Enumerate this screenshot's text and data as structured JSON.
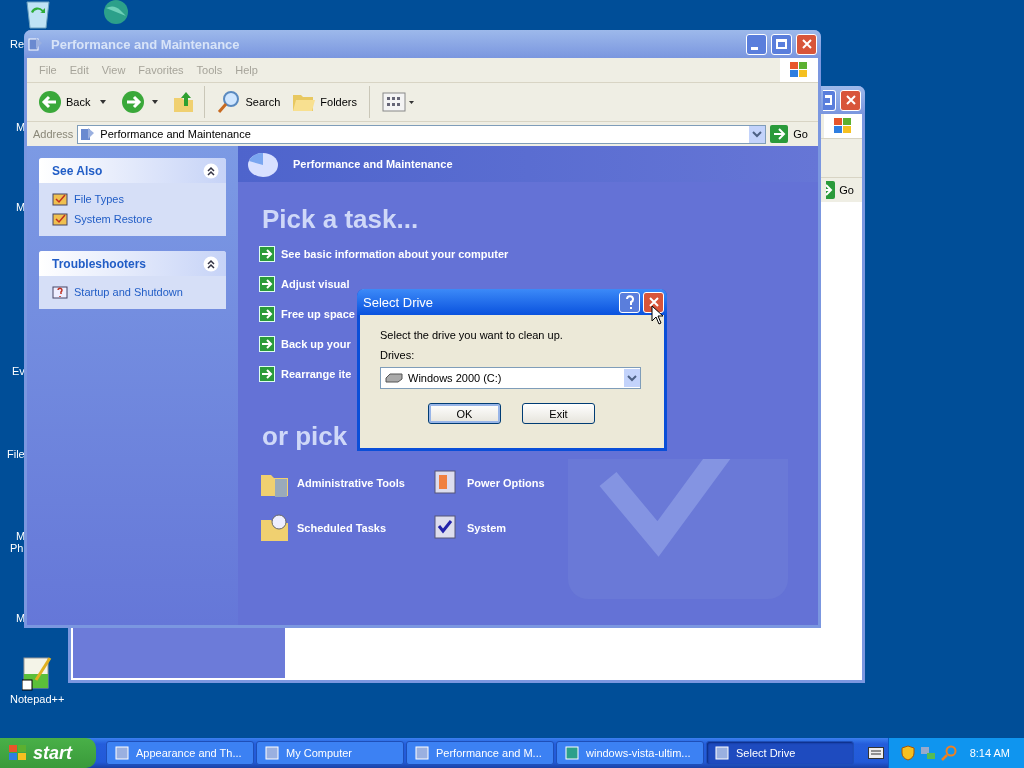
{
  "desktop_labels": [
    "Re",
    "M",
    "M",
    "Ev",
    "File",
    "M",
    "Ph",
    "M",
    "Notepad++"
  ],
  "back_window": {
    "go_label": "Go"
  },
  "main_window": {
    "title": "Performance and Maintenance",
    "menu": [
      "File",
      "Edit",
      "View",
      "Favorites",
      "Tools",
      "Help"
    ],
    "toolbar": {
      "back": "Back",
      "search": "Search",
      "folders": "Folders"
    },
    "address": {
      "label": "Address",
      "value": "Performance and Maintenance",
      "go": "Go"
    },
    "side_panels": [
      {
        "title": "See Also",
        "expanded": true,
        "items": [
          "File Types",
          "System Restore"
        ]
      },
      {
        "title": "Troubleshooters",
        "expanded": true,
        "items": [
          "Startup and Shutdown"
        ]
      }
    ],
    "header": "Performance and Maintenance",
    "pick_task": "Pick a task...",
    "tasks": [
      "See basic information about your computer",
      "Adjust visual",
      "Free up space",
      "Back up your",
      "Rearrange ite"
    ],
    "or_pick": "or pick",
    "icons": [
      "Administrative Tools",
      "Power Options",
      "Scheduled Tasks",
      "System"
    ]
  },
  "dialog": {
    "title": "Select Drive",
    "prompt": "Select the drive you want to clean up.",
    "drives_label": "Drives:",
    "drive": "Windows 2000 (C:)",
    "buttons": [
      "OK",
      "Exit"
    ]
  },
  "taskbar": {
    "start": "start",
    "buttons": [
      {
        "label": "Appearance and Th...",
        "selected": false
      },
      {
        "label": "My Computer",
        "selected": false
      },
      {
        "label": "Performance and M...",
        "selected": false
      },
      {
        "label": "windows-vista-ultim...",
        "selected": false
      },
      {
        "label": "Select Drive",
        "selected": true
      }
    ],
    "clock": "8:14 AM"
  }
}
